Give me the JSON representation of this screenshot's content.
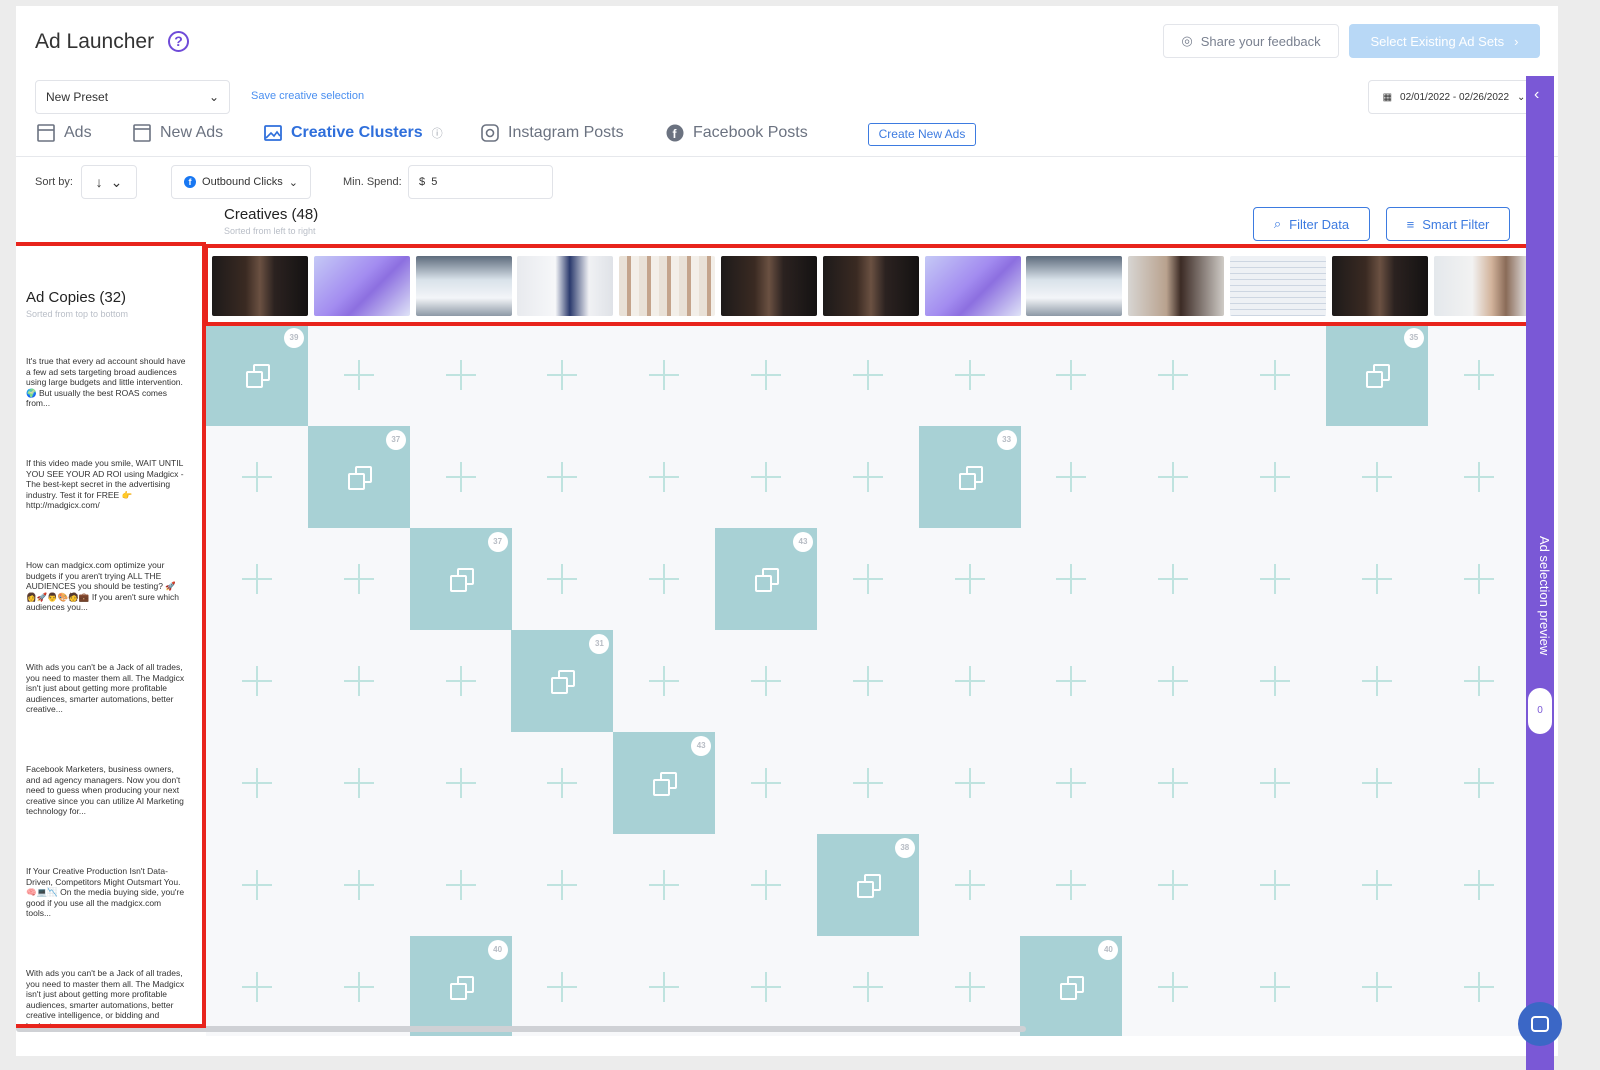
{
  "app": {
    "title": "Ad Launcher",
    "help_icon": "?"
  },
  "header": {
    "feedback_label": "Share your feedback",
    "select_existing_label": "Select Existing Ad Sets"
  },
  "preset": {
    "value": "New Preset",
    "save_link": "Save creative selection"
  },
  "date_range": {
    "value": "02/01/2022 - 02/26/2022"
  },
  "tabs": [
    {
      "label": "Ads",
      "icon": "square-icon",
      "active": false
    },
    {
      "label": "New Ads",
      "icon": "document-icon",
      "active": false
    },
    {
      "label": "Creative Clusters",
      "icon": "image-icon",
      "active": true
    },
    {
      "label": "Instagram Posts",
      "icon": "instagram-icon",
      "active": false
    },
    {
      "label": "Facebook Posts",
      "icon": "facebook-icon",
      "active": false
    }
  ],
  "create_new_ads_label": "Create New Ads",
  "toolbar": {
    "sort_label": "Sort by:",
    "sort_direction_icon": "arrow-down-icon",
    "metric_value": "Outbound Clicks",
    "min_spend_label": "Min. Spend:",
    "min_spend_currency": "$",
    "min_spend_value": "5"
  },
  "creatives": {
    "title": "Creatives (48)",
    "subtitle": "Sorted from left to right",
    "filter_data_label": "Filter Data",
    "smart_filter_label": "Smart Filter"
  },
  "ad_copies": {
    "title": "Ad Copies (32)",
    "subtitle": "Sorted from top to bottom",
    "items": [
      "It's true that every ad account should have a few ad sets targeting broad audiences using large budgets and little intervention. 🌍 But usually the best ROAS comes from...",
      "If this video made you smile, WAIT UNTIL YOU SEE YOUR AD ROI using Madgicx - The best-kept secret in the advertising industry. Test it for FREE 👉 http://madgicx.com/",
      "How can madgicx.com optimize your budgets if you aren't trying ALL THE AUDIENCES you should be testing? 🚀 👩🚀👨🎨🧑💼 If you aren't sure which audiences you...",
      "With ads you can't be a Jack of all trades, you need to master them all. The Madgicx isn't just about getting more profitable audiences, smarter automations, better creative...",
      "Facebook Marketers, business owners, and ad agency managers. Now you don't need to guess when producing your next creative since you can utilize AI Marketing technology for...",
      "If Your Creative Production Isn't Data-Driven, Competitors Might Outsmart You. 🧠💻📉 On the media buying side, you're good if you use all the madgicx.com tools...",
      "With ads you can't be a Jack of all trades, you need to master them all. The Madgicx isn't just about getting more profitable audiences, smarter automations, better creative intelligence, or bidding and budget..."
    ]
  },
  "thumbnails": [
    "video-dark-man",
    "3d-purple-character",
    "laptop-dashboard",
    "presenter-whiteboard",
    "grid-of-products",
    "video-dark-man",
    "video-dark-man",
    "3d-purple-character",
    "laptop-dashboard",
    "man-headset",
    "dashboard-table",
    "video-dark-man",
    "man-webcam"
  ],
  "matrix": {
    "columns": 13,
    "rows": 7,
    "selected": [
      {
        "row": 0,
        "col": 0,
        "count": "39"
      },
      {
        "row": 0,
        "col": 11,
        "count": "35"
      },
      {
        "row": 1,
        "col": 1,
        "count": "37"
      },
      {
        "row": 1,
        "col": 7,
        "count": "33"
      },
      {
        "row": 2,
        "col": 2,
        "count": "37"
      },
      {
        "row": 2,
        "col": 5,
        "count": "43"
      },
      {
        "row": 3,
        "col": 3,
        "count": "31"
      },
      {
        "row": 4,
        "col": 4,
        "count": "43"
      },
      {
        "row": 5,
        "col": 6,
        "count": "38"
      },
      {
        "row": 6,
        "col": 2,
        "count": "40"
      },
      {
        "row": 6,
        "col": 8,
        "count": "40"
      }
    ]
  },
  "side_panel": {
    "label": "Ad selection preview",
    "count": "0"
  },
  "colors": {
    "accent": "#3d7be0",
    "selected_cell": "#a8d1d5",
    "side_panel": "#7a58d6",
    "highlight": "#e8241c"
  }
}
